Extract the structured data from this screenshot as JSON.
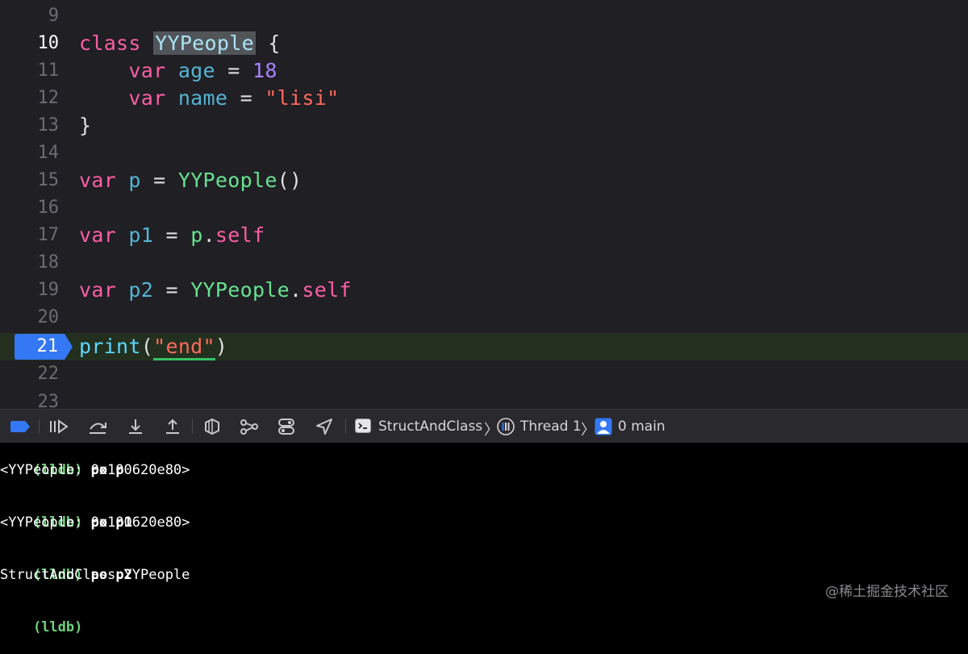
{
  "editor": {
    "lines": [
      {
        "num": "9"
      },
      {
        "num": "10"
      },
      {
        "num": "11"
      },
      {
        "num": "12"
      },
      {
        "num": "13"
      },
      {
        "num": "14"
      },
      {
        "num": "15"
      },
      {
        "num": "16"
      },
      {
        "num": "17"
      },
      {
        "num": "18"
      },
      {
        "num": "19"
      },
      {
        "num": "20"
      },
      {
        "num": "21"
      },
      {
        "num": "22"
      },
      {
        "num": "23"
      }
    ],
    "code": {
      "l10": {
        "kw": "class",
        "name": "YYPeople",
        "brace": "{"
      },
      "l11": {
        "kw": "var",
        "name": "age",
        "eq": "=",
        "val": "18"
      },
      "l12": {
        "kw": "var",
        "name": "name",
        "eq": "=",
        "val": "\"lisi\""
      },
      "l13": {
        "brace": "}"
      },
      "l15": {
        "kw": "var",
        "name": "p",
        "eq": "=",
        "type": "YYPeople",
        "call": "()"
      },
      "l17": {
        "kw": "var",
        "name": "p1",
        "eq": "=",
        "obj": "p",
        "dot": ".",
        "prop": "self"
      },
      "l19": {
        "kw": "var",
        "name": "p2",
        "eq": "=",
        "type": "YYPeople",
        "dot": ".",
        "prop": "self"
      },
      "l21": {
        "fn": "print",
        "open": "(",
        "str": "\"end\"",
        "close": ")"
      }
    },
    "breakpoint_line": "21",
    "colors": {
      "keyword": "#fc5fa3",
      "type": "#67e28f",
      "string": "#fc6a5d",
      "number": "#a783ff",
      "variable": "#55b4d4",
      "breakpoint": "#3478f6",
      "current_line": "#23301f"
    }
  },
  "debugbar": {
    "icons": [
      "breakpoints-toggle-icon",
      "continue-icon",
      "step-over-icon",
      "step-into-icon",
      "step-out-icon",
      "view-hierarchy-icon",
      "memory-graph-icon",
      "environment-overrides-icon",
      "simulate-location-icon"
    ],
    "breadcrumb": {
      "target": "StructAndClass",
      "thread": "Thread 1",
      "frame": "0 main"
    }
  },
  "console": {
    "entries": [
      {
        "prompt": "(lldb)",
        "cmd": "po p",
        "output": "<YYPeople: 0x100620e80>"
      },
      {
        "prompt": "(lldb)",
        "cmd": "po p1",
        "output": "<YYPeople: 0x100620e80>"
      },
      {
        "prompt": "(lldb)",
        "cmd": "po p2",
        "output": "StructAndClass.YYPeople"
      }
    ],
    "final_prompt": "(lldb)"
  },
  "watermark": "@稀土掘金技术社区"
}
